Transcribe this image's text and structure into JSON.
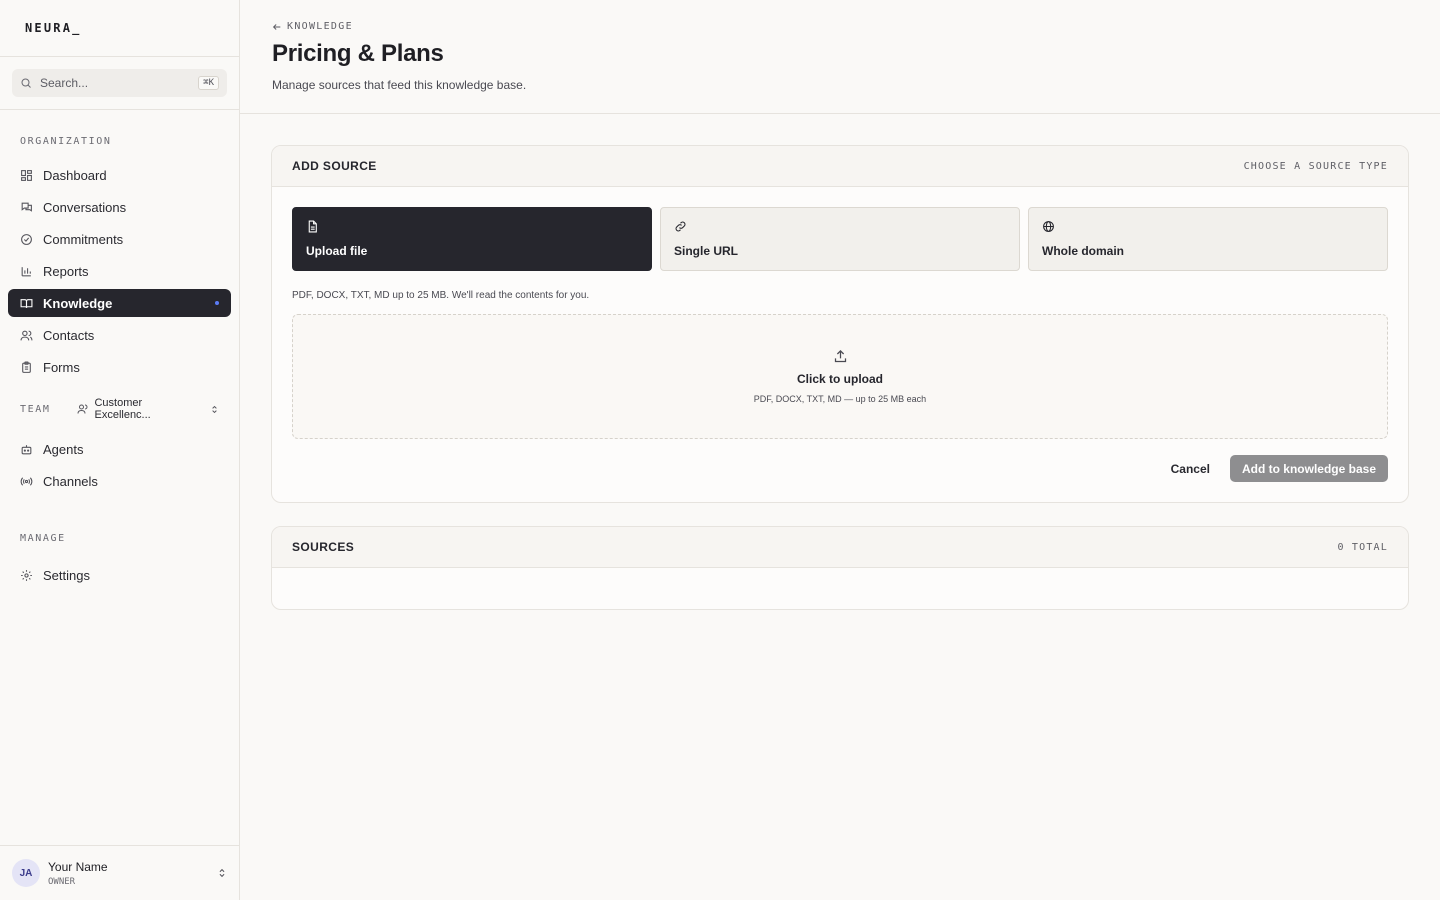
{
  "brand": "NEURA_",
  "search": {
    "placeholder": "Search...",
    "shortcut": "⌘K"
  },
  "sidebar": {
    "organization_label": "ORGANIZATION",
    "org_items": [
      {
        "label": "Dashboard",
        "icon": "dashboard-icon"
      },
      {
        "label": "Conversations",
        "icon": "conversations-icon"
      },
      {
        "label": "Commitments",
        "icon": "check-circle-icon"
      },
      {
        "label": "Reports",
        "icon": "bar-chart-icon"
      },
      {
        "label": "Knowledge",
        "icon": "book-icon",
        "active": true
      },
      {
        "label": "Contacts",
        "icon": "contacts-icon"
      },
      {
        "label": "Forms",
        "icon": "clipboard-icon"
      }
    ],
    "team_label": "TEAM",
    "team_name": "Customer Excellenc...",
    "team_items": [
      {
        "label": "Agents",
        "icon": "bot-icon"
      },
      {
        "label": "Channels",
        "icon": "broadcast-icon"
      }
    ],
    "manage_label": "MANAGE",
    "manage_items": [
      {
        "label": "Settings",
        "icon": "gear-icon"
      }
    ],
    "user": {
      "initials": "JA",
      "name": "Your Name",
      "role": "OWNER"
    }
  },
  "header": {
    "back_label": "KNOWLEDGE",
    "title": "Pricing & Plans",
    "subtitle": "Manage sources that feed this knowledge base."
  },
  "add_source": {
    "title": "ADD SOURCE",
    "meta": "CHOOSE A SOURCE TYPE",
    "types": [
      {
        "label": "Upload file",
        "icon": "file-icon",
        "selected": true
      },
      {
        "label": "Single URL",
        "icon": "link-icon",
        "selected": false
      },
      {
        "label": "Whole domain",
        "icon": "globe-icon",
        "selected": false
      }
    ],
    "hint": "PDF, DOCX, TXT, MD up to 25 MB. We'll read the contents for you.",
    "dropzone_title": "Click to upload",
    "dropzone_sub": "PDF, DOCX, TXT, MD — up to 25 MB each",
    "cancel_label": "Cancel",
    "submit_label": "Add to knowledge base"
  },
  "sources": {
    "title": "SOURCES",
    "count_label": "0 TOTAL"
  },
  "colors": {
    "primary_dark": "#26262d",
    "accent_dot": "#5b7cf5",
    "disabled_button": "#8e8e90"
  }
}
